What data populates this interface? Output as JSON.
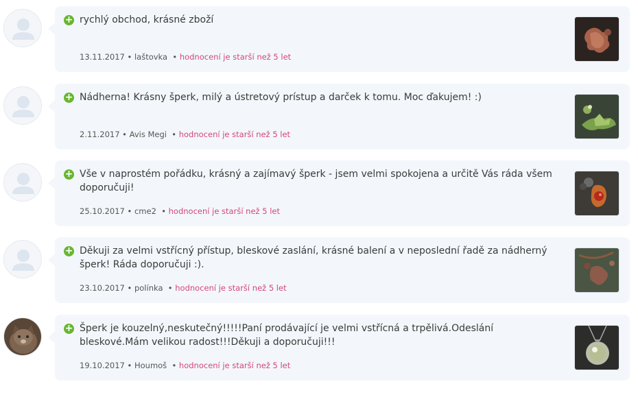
{
  "old_label": "hodnocení je starší než 5 let",
  "reviews": [
    {
      "text": "rychlý obchod, krásné zboží",
      "date": "13.11.2017",
      "author": "laštovka",
      "avatar": "default-user-icon",
      "thumb": "copper-oak-leaf-pendant"
    },
    {
      "text": "Nádherna! Krásny šperk, milý a ústretový prístup a darček k tomu. Moc ďakujem! :)",
      "date": "2.11.2017",
      "author": "Avis Megi",
      "avatar": "default-user-icon",
      "thumb": "green-leaf-jewelry"
    },
    {
      "text": "Vše v naprostém pořádku, krásný a zajímavý šperk - jsem velmi spokojena a určitě Vás ráda všem doporučuji!",
      "date": "25.10.2017",
      "author": "cme2",
      "avatar": "default-user-icon",
      "thumb": "red-berry-pendant"
    },
    {
      "text": "Děkuji za velmi vstřícný přístup, bleskové zaslání, krásné balení a v neposlední řadě za nádherný šperk! Ráda doporučuji :).",
      "date": "23.10.2017",
      "author": "polínka",
      "avatar": "default-user-icon",
      "thumb": "copper-leaf-acorn-jewelry"
    },
    {
      "text": "Šperk je kouzelný,neskutečný!!!!!Paní prodávající je velmi vstřícná a trpělivá.Odeslání bleskové.Mám velikou radost!!!Děkuji a doporučuji!!!",
      "date": "19.10.2017",
      "author": "Houmoš",
      "avatar": "user-photo-cat",
      "thumb": "glass-sphere-pendant"
    }
  ]
}
